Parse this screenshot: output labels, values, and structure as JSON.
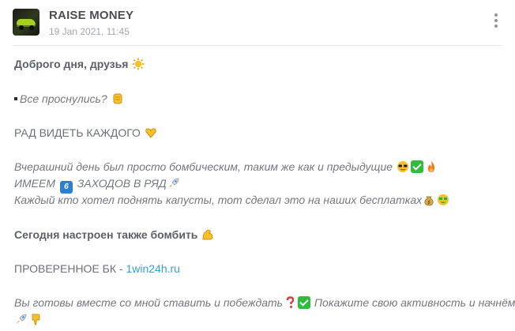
{
  "channel": {
    "name": "RAISE MONEY",
    "date": "19 Jan 2021, 11:45"
  },
  "post": {
    "greeting": "Доброго дня, друзья",
    "question": "Все проснулись?",
    "glad": "РАД ВИДЕТЬ КАЖДОГО",
    "yesterday": "Вчерашний день был просто бомбическим, таким же как и предыдущие",
    "streak_prefix": "ИМЕЕМ",
    "streak_number": "6",
    "streak_suffix": "ЗАХОДОВ В РЯД",
    "cabbage": "Каждый кто хотел поднять капусты, тот сделал это на наших бесплатках",
    "today": "Сегодня настроен также бомбить",
    "bk_label": "ПРОВЕРЕННОЕ БК - ",
    "bk_link": "1win24h.ru",
    "closing": "Вы готовы вместе со мной ставить и побеждать",
    "closing2": "Покажите свою активность и начнём"
  },
  "icons": [
    "sun-emoji",
    "fist-emoji",
    "heart-hands-emoji",
    "sunglasses-emoji",
    "check-emoji",
    "fire-emoji",
    "keycap-6-emoji",
    "rocket-emoji",
    "money-bag-emoji",
    "money-face-emoji",
    "biceps-emoji",
    "question-emoji",
    "thumbs-down-emoji",
    "more-vertical-icon"
  ],
  "colors": {
    "link": "#3a9fd6",
    "text": "#6b6f78",
    "accent_check": "#2ebd3b"
  }
}
